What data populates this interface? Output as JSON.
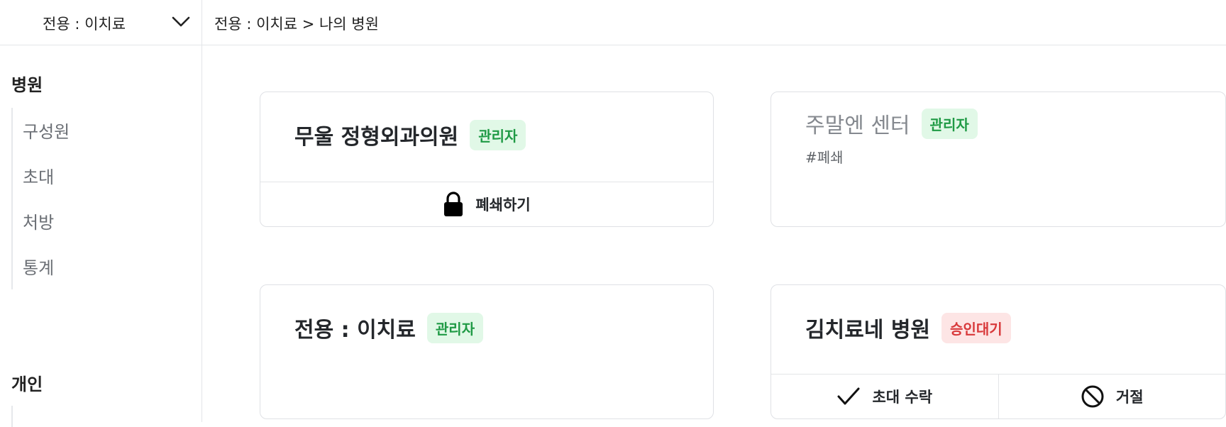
{
  "header": {
    "org_selector_label": "전용 : 이치료",
    "breadcrumb": "전용 : 이치료 > 나의 병원"
  },
  "sidebar": {
    "sections": [
      {
        "title": "병원",
        "items": [
          "구성원",
          "초대",
          "처방",
          "통계"
        ]
      },
      {
        "title": "개인"
      }
    ]
  },
  "cards": [
    {
      "name": "무울 정형외과의원",
      "badge": "관리자",
      "actions": [
        {
          "label": "폐쇄하기",
          "icon": "lock-icon"
        }
      ]
    },
    {
      "name": "주말엔 센터",
      "badge": "관리자",
      "tag": "#폐쇄"
    },
    {
      "name": "전용 : 이치료",
      "badge": "관리자"
    },
    {
      "name": "김치료네 병원",
      "badge": "승인대기",
      "actions": [
        {
          "label": "초대 수락",
          "icon": "check-icon"
        },
        {
          "label": "거절",
          "icon": "ban-icon"
        }
      ]
    }
  ],
  "colors": {
    "admin_badge_bg": "#e1f8e7",
    "admin_badge_text": "#1f9a45",
    "pending_badge_bg": "#fde5e5",
    "pending_badge_text": "#d8383a",
    "border": "#dfe1e5"
  }
}
